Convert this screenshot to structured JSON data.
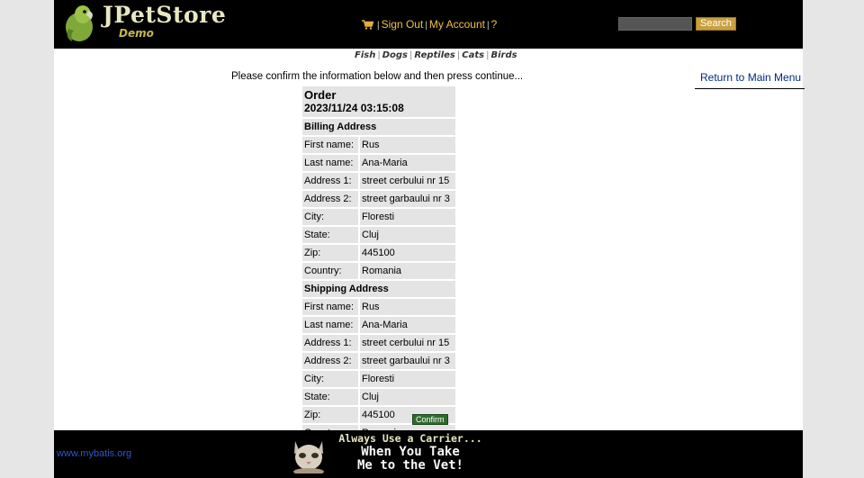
{
  "header": {
    "brand": "JPetStore",
    "brand_sub": "Demo",
    "menu": {
      "sign_out": "Sign Out",
      "my_account": "My Account",
      "help": "?",
      "separator": "|"
    },
    "search": {
      "value": "",
      "button": "Search"
    }
  },
  "quicklinks": [
    "Fish",
    "Dogs",
    "Reptiles",
    "Cats",
    "Birds"
  ],
  "content": {
    "prompt": "Please confirm the information below and then press continue...",
    "return_link": "Return to Main Menu",
    "order": {
      "title": "Order",
      "datetime": "2023/11/24 03:15:08",
      "billing": {
        "heading": "Billing Address",
        "rows": [
          {
            "label": "First name:",
            "value": "Rus"
          },
          {
            "label": "Last name:",
            "value": "Ana-Maria"
          },
          {
            "label": "Address 1:",
            "value": "street cerbului nr 15"
          },
          {
            "label": "Address 2:",
            "value": "street garbaului nr 3"
          },
          {
            "label": "City:",
            "value": "Floresti"
          },
          {
            "label": "State:",
            "value": "Cluj"
          },
          {
            "label": "Zip:",
            "value": "445100"
          },
          {
            "label": "Country:",
            "value": "Romania"
          }
        ]
      },
      "shipping": {
        "heading": "Shipping Address",
        "rows": [
          {
            "label": "First name:",
            "value": "Rus"
          },
          {
            "label": "Last name:",
            "value": "Ana-Maria"
          },
          {
            "label": "Address 1:",
            "value": "street cerbului nr 15"
          },
          {
            "label": "Address 2:",
            "value": "street garbaului nr 3"
          },
          {
            "label": "City:",
            "value": "Floresti"
          },
          {
            "label": "State:",
            "value": "Cluj"
          },
          {
            "label": "Zip:",
            "value": "445100"
          },
          {
            "label": "Country:",
            "value": "Romania"
          }
        ]
      }
    },
    "confirm_button": "Confirm"
  },
  "footer": {
    "link": "www.mybatis.org",
    "banner": {
      "line1": "Always Use a Carrier...",
      "line2": "When You Take",
      "line3": "Me to the Vet!"
    }
  },
  "colors": {
    "header_bg": "#000000",
    "menu_link": "#f0c040",
    "confirm_bg": "#2f6b2f",
    "table_cell": "#e4e4e4"
  },
  "icons": [
    "parrot-logo-icon",
    "cart-icon",
    "cat-icon"
  ]
}
